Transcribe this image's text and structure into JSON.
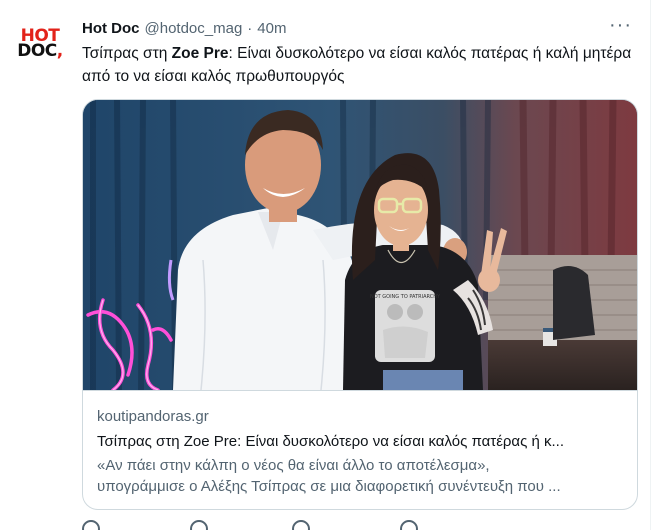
{
  "tweet": {
    "logo_line1": "HOT",
    "logo_line2": "DOC",
    "display_name": "Hot Doc",
    "handle": "@hotdoc_mag",
    "separator": "·",
    "time": "40m",
    "more_label": "···",
    "text_pre": "Τσίπρας στη ",
    "text_bold": "Zoe Pre",
    "text_post": ": Είναι δυσκολότερο να είσαι καλός πατέρας ή καλή μητέρα από το να είσαι καλός πρωθυπουργός"
  },
  "card": {
    "domain": "koutipandoras.gr",
    "title": "Τσίπρας στη Zoe Pre: Είναι δυσκολότερο να είσαι καλός πατέρας ή κ...",
    "desc_line1": "«Αν πάει στην κάλπη ο νέος θα είναι άλλο το αποτέλεσμα»,",
    "desc_line2": "υπογράμμισε ο Αλέξης Τσίπρας σε μια διαφορετική συνέντευξη που ...",
    "tshirt_text": "NOT GOING TO PATRIARCHY"
  },
  "colors": {
    "brand_red": "#e2231a",
    "text_primary": "#0f1419",
    "text_secondary": "#536471",
    "border": "#cfd9de",
    "neon_pink": "#ff4fd8"
  },
  "icons": [
    "more-icon",
    "reply-icon",
    "retweet-icon",
    "like-icon",
    "share-icon"
  ]
}
